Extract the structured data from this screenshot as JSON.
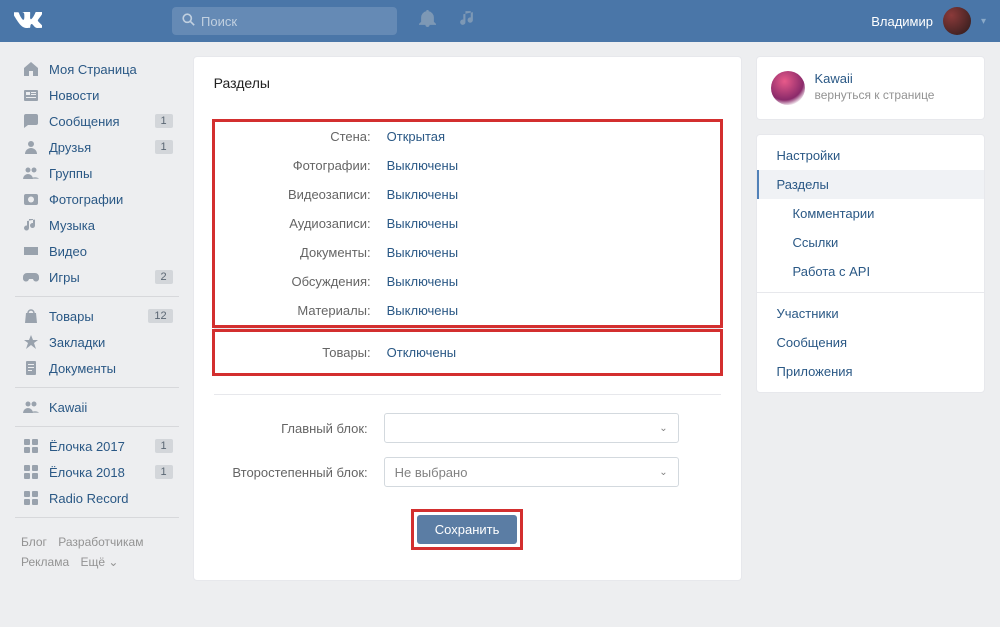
{
  "header": {
    "search_placeholder": "Поиск",
    "username": "Владимир"
  },
  "sidebar": {
    "items": [
      {
        "icon": "home",
        "label": "Моя Страница",
        "badge": null
      },
      {
        "icon": "news",
        "label": "Новости",
        "badge": null
      },
      {
        "icon": "msg",
        "label": "Сообщения",
        "badge": "1"
      },
      {
        "icon": "friends",
        "label": "Друзья",
        "badge": "1"
      },
      {
        "icon": "groups",
        "label": "Группы",
        "badge": null
      },
      {
        "icon": "photo",
        "label": "Фотографии",
        "badge": null
      },
      {
        "icon": "music",
        "label": "Музыка",
        "badge": null
      },
      {
        "icon": "video",
        "label": "Видео",
        "badge": null
      },
      {
        "icon": "games",
        "label": "Игры",
        "badge": "2"
      }
    ],
    "items2": [
      {
        "icon": "market",
        "label": "Товары",
        "badge": "12"
      },
      {
        "icon": "bookmark",
        "label": "Закладки",
        "badge": null
      },
      {
        "icon": "docs",
        "label": "Документы",
        "badge": null
      }
    ],
    "items3": [
      {
        "icon": "groups",
        "label": "Kawaii",
        "badge": null
      }
    ],
    "items4": [
      {
        "icon": "app",
        "label": "Ёлочка 2017",
        "badge": "1"
      },
      {
        "icon": "app",
        "label": "Ёлочка 2018",
        "badge": "1"
      },
      {
        "icon": "app",
        "label": "Radio Record",
        "badge": null
      }
    ]
  },
  "footer": {
    "l1": "Блог",
    "l2": "Разработчикам",
    "l3": "Реклама",
    "l4": "Ещё ⌄"
  },
  "main": {
    "title": "Разделы",
    "settings": [
      {
        "label": "Стена:",
        "value": "Открытая"
      },
      {
        "label": "Фотографии:",
        "value": "Выключены"
      },
      {
        "label": "Видеозаписи:",
        "value": "Выключены"
      },
      {
        "label": "Аудиозаписи:",
        "value": "Выключены"
      },
      {
        "label": "Документы:",
        "value": "Выключены"
      },
      {
        "label": "Обсуждения:",
        "value": "Выключены"
      },
      {
        "label": "Материалы:",
        "value": "Выключены"
      }
    ],
    "settings2": [
      {
        "label": "Товары:",
        "value": "Отключены"
      }
    ],
    "main_block_label": "Главный блок:",
    "main_block_value": "",
    "secondary_block_label": "Второстепенный блок:",
    "secondary_block_value": "Не выбрано",
    "save": "Сохранить"
  },
  "right": {
    "group_name": "Kawaii",
    "group_back": "вернуться к странице",
    "nav": [
      {
        "label": "Настройки",
        "sub": false,
        "active": false
      },
      {
        "label": "Разделы",
        "sub": true,
        "active": true
      },
      {
        "label": "Комментарии",
        "sub": true,
        "active": false
      },
      {
        "label": "Ссылки",
        "sub": true,
        "active": false
      },
      {
        "label": "Работа с API",
        "sub": true,
        "active": false
      }
    ],
    "nav2": [
      {
        "label": "Участники"
      },
      {
        "label": "Сообщения"
      },
      {
        "label": "Приложения"
      }
    ]
  }
}
